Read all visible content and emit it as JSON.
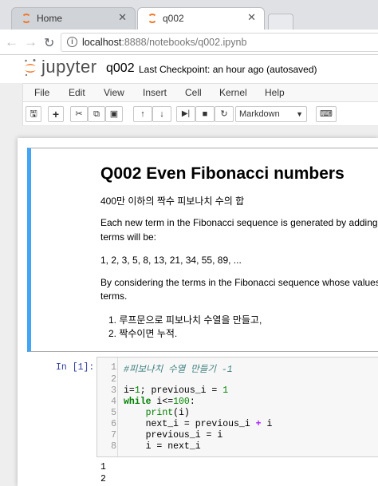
{
  "browser": {
    "tabs": [
      {
        "label": "Home"
      },
      {
        "label": "q002"
      }
    ],
    "url_host": "localhost",
    "url_rest": ":8888/notebooks/q002.ipynb"
  },
  "jupyter": {
    "logo_text": "jupyter",
    "notebook_title": "q002",
    "checkpoint_label": "Last Checkpoint:",
    "checkpoint_value": "an hour ago (autosaved)"
  },
  "menu": [
    "File",
    "Edit",
    "View",
    "Insert",
    "Cell",
    "Kernel",
    "Help"
  ],
  "toolbar": {
    "cell_type": "Markdown"
  },
  "markdown_cell": {
    "heading": "Q002 Even Fibonacci numbers",
    "subtitle": "400만 이하의 짝수 피보나치 수의 합",
    "para1_line1": "Each new term in the Fibonacci sequence is generated by adding t",
    "para1_line2": "terms will be:",
    "sequence": "1, 2, 3, 5, 8, 13, 21, 34, 55, 89, ...",
    "para2_line1": "By considering the terms in the Fibonacci sequence whose values",
    "para2_line2": "terms.",
    "list": [
      "루프문으로 피보나치 수열을 만들고,",
      "짝수이면 누적."
    ]
  },
  "code_cell": {
    "prompt": "In [1]:",
    "line_numbers": [
      "1",
      "2",
      "3",
      "4",
      "5",
      "6",
      "7",
      "8"
    ],
    "comment": "#피보나치 수열 만들기 -1",
    "output": [
      "1",
      "2"
    ]
  },
  "colors": {
    "selected_cell_border": "#42a5f5",
    "prompt_in": "#303f9f",
    "jupyter_orange": "#f37626"
  }
}
